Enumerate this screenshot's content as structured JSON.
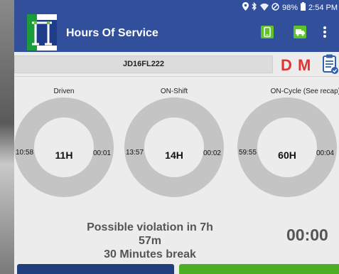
{
  "statusbar": {
    "battery": "98%",
    "time": "2:54 PM"
  },
  "appbar": {
    "title": "Hours Of Service"
  },
  "vehicle": {
    "id": "JD16FL222"
  },
  "duty": {
    "d": "D",
    "m": "M"
  },
  "gauges": [
    {
      "label": "Driven",
      "center": "11H",
      "left": "10:58",
      "right": "00:01"
    },
    {
      "label": "ON-Shift",
      "center": "14H",
      "left": "13:57",
      "right": "00:02"
    },
    {
      "label": "ON-Cycle (See recap)",
      "center": "60H",
      "left": "59:55",
      "right": "00:04"
    }
  ],
  "violation": {
    "line1": "Possible violation in 7h 57m",
    "line2": "30 Minutes break"
  },
  "timer": "00:00",
  "colors": {
    "header": "#324f9c",
    "accent_green": "#5fc32b",
    "alert_red": "#e23232",
    "dark_button": "#223d7e",
    "green_button": "#4caf23"
  }
}
